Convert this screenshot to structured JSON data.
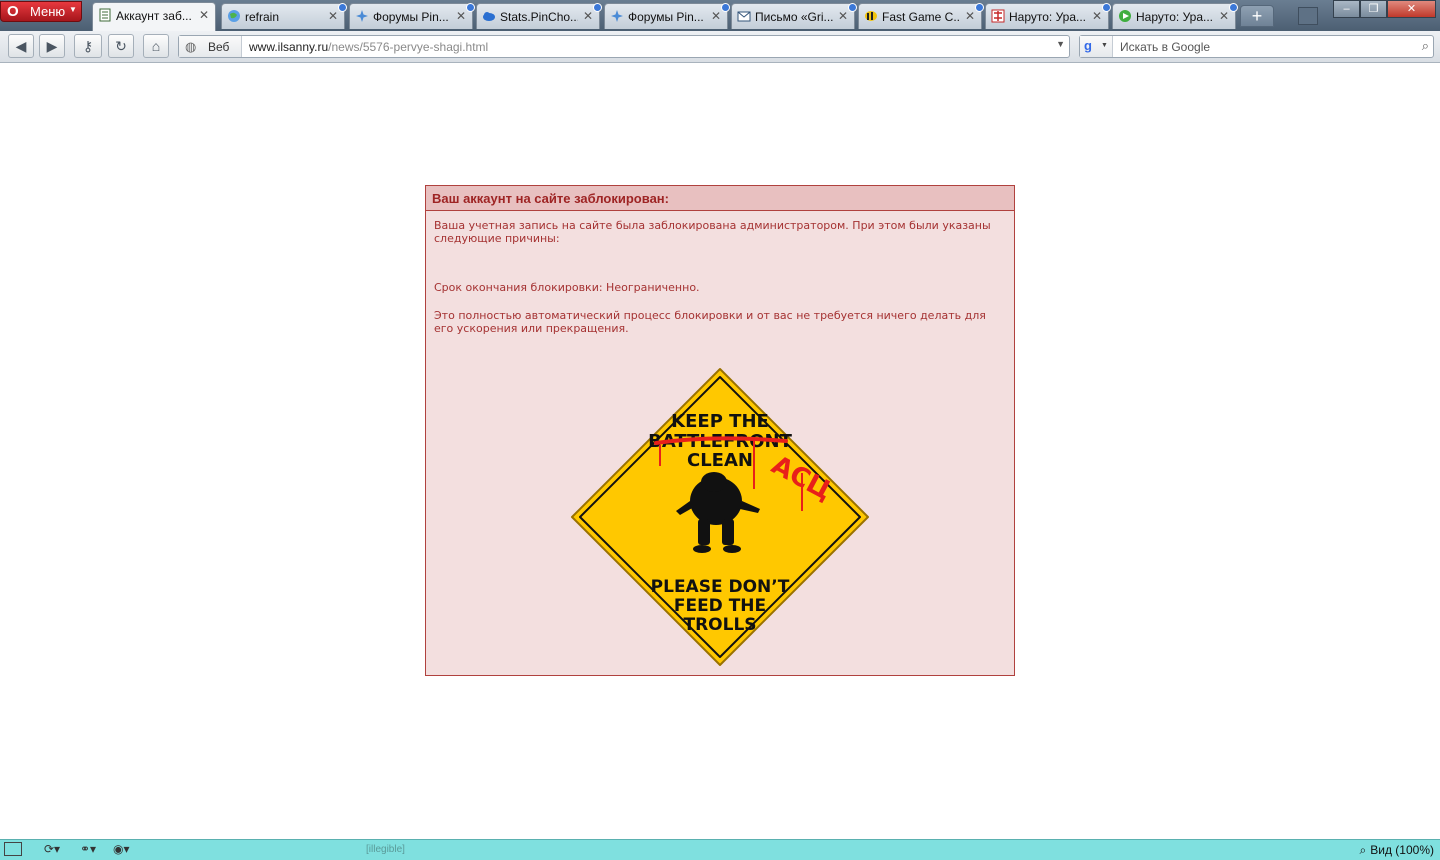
{
  "browser": {
    "menu_label": "Меню",
    "tabs": [
      {
        "title": "Аккаунт заб...",
        "icon": "page-icon",
        "active": true
      },
      {
        "title": "refrain",
        "icon": "globe-icon",
        "active": false
      },
      {
        "title": "Форумы Pin...",
        "icon": "pinterest-star-icon",
        "active": false
      },
      {
        "title": "Stats.PinCho...",
        "icon": "cloud-icon",
        "active": false
      },
      {
        "title": "Форумы Pin...",
        "icon": "pinterest-star-icon",
        "active": false
      },
      {
        "title": "Письмо «Gri...",
        "icon": "mail-icon",
        "active": false
      },
      {
        "title": "Fast Game C...",
        "icon": "bee-icon",
        "active": false
      },
      {
        "title": "Наруто: Ура...",
        "icon": "kanji-icon",
        "active": false
      },
      {
        "title": "Наруто: Ура...",
        "icon": "play-icon",
        "active": false
      }
    ],
    "address": {
      "label": "Веб",
      "url_domain": "www.ilsanny.ru",
      "url_path": "/news/5576-pervye-shagi.html"
    },
    "search_placeholder": "Искать в Google",
    "status": {
      "tooltip": "[illegible]",
      "zoom_label": "Вид (100%)"
    }
  },
  "page": {
    "ban_title": "Ваш аккаунт на сайте заблокирован:",
    "ban_message": "Ваша учетная запись на сайте была заблокирована администратором. При этом были указаны следующие причины:",
    "ban_expiry": "Срок окончания блокировки: Неограниченно.",
    "ban_auto_note": "Это полностью автоматический процесс блокировки и от вас не требуется ничего делать для его ускорения или прекращения.",
    "sign": {
      "line1": "KEEP THE",
      "line2": "BATTLEFRONT",
      "line3": "CLEAN",
      "graffiti": "АСЦ",
      "bottom1": "PLEASE DON’T",
      "bottom2": "FEED THE",
      "bottom3": "TROLLS",
      "sign_color": "#ffc800",
      "graffiti_color": "#e8201a"
    }
  },
  "colors": {
    "box_border": "#b0413e",
    "box_bg": "#f3dfdf",
    "text_red": "#a53232",
    "status_bg": "#7fe0df"
  }
}
